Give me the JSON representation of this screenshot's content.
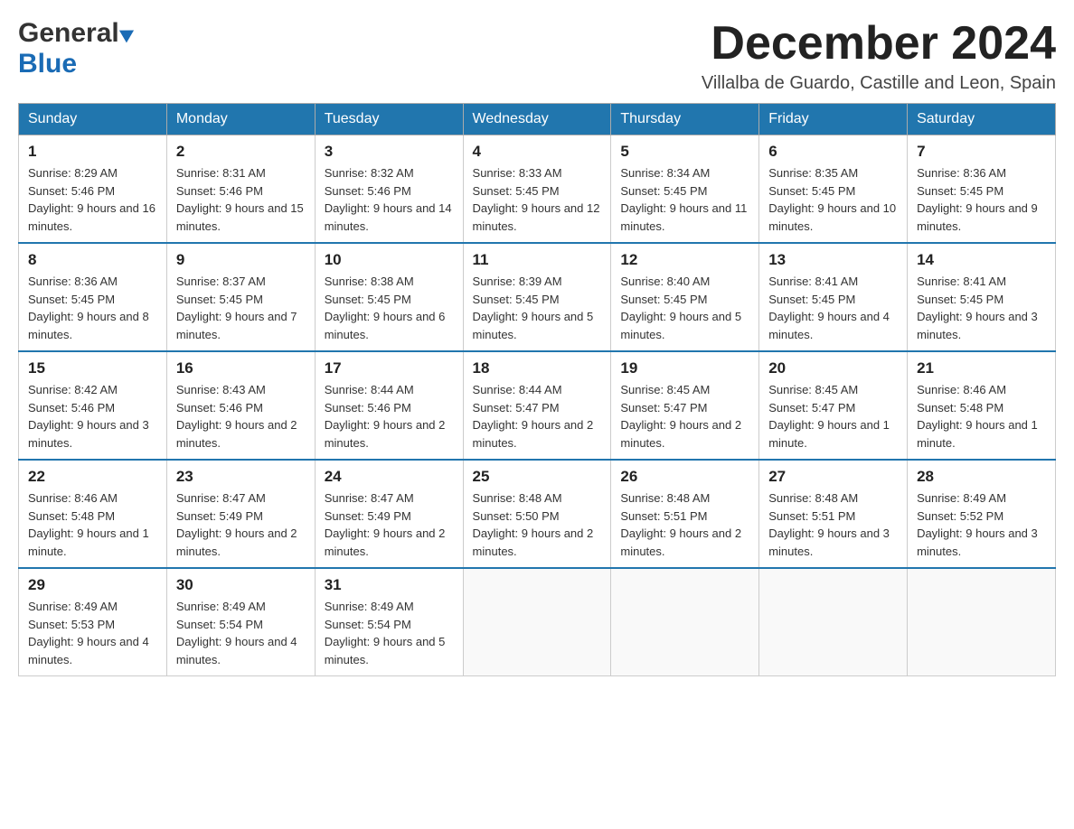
{
  "header": {
    "logo_general": "General",
    "logo_blue": "Blue",
    "month_title": "December 2024",
    "subtitle": "Villalba de Guardo, Castille and Leon, Spain"
  },
  "days_of_week": [
    "Sunday",
    "Monday",
    "Tuesday",
    "Wednesday",
    "Thursday",
    "Friday",
    "Saturday"
  ],
  "weeks": [
    [
      {
        "day": "1",
        "sunrise": "Sunrise: 8:29 AM",
        "sunset": "Sunset: 5:46 PM",
        "daylight": "Daylight: 9 hours and 16 minutes."
      },
      {
        "day": "2",
        "sunrise": "Sunrise: 8:31 AM",
        "sunset": "Sunset: 5:46 PM",
        "daylight": "Daylight: 9 hours and 15 minutes."
      },
      {
        "day": "3",
        "sunrise": "Sunrise: 8:32 AM",
        "sunset": "Sunset: 5:46 PM",
        "daylight": "Daylight: 9 hours and 14 minutes."
      },
      {
        "day": "4",
        "sunrise": "Sunrise: 8:33 AM",
        "sunset": "Sunset: 5:45 PM",
        "daylight": "Daylight: 9 hours and 12 minutes."
      },
      {
        "day": "5",
        "sunrise": "Sunrise: 8:34 AM",
        "sunset": "Sunset: 5:45 PM",
        "daylight": "Daylight: 9 hours and 11 minutes."
      },
      {
        "day": "6",
        "sunrise": "Sunrise: 8:35 AM",
        "sunset": "Sunset: 5:45 PM",
        "daylight": "Daylight: 9 hours and 10 minutes."
      },
      {
        "day": "7",
        "sunrise": "Sunrise: 8:36 AM",
        "sunset": "Sunset: 5:45 PM",
        "daylight": "Daylight: 9 hours and 9 minutes."
      }
    ],
    [
      {
        "day": "8",
        "sunrise": "Sunrise: 8:36 AM",
        "sunset": "Sunset: 5:45 PM",
        "daylight": "Daylight: 9 hours and 8 minutes."
      },
      {
        "day": "9",
        "sunrise": "Sunrise: 8:37 AM",
        "sunset": "Sunset: 5:45 PM",
        "daylight": "Daylight: 9 hours and 7 minutes."
      },
      {
        "day": "10",
        "sunrise": "Sunrise: 8:38 AM",
        "sunset": "Sunset: 5:45 PM",
        "daylight": "Daylight: 9 hours and 6 minutes."
      },
      {
        "day": "11",
        "sunrise": "Sunrise: 8:39 AM",
        "sunset": "Sunset: 5:45 PM",
        "daylight": "Daylight: 9 hours and 5 minutes."
      },
      {
        "day": "12",
        "sunrise": "Sunrise: 8:40 AM",
        "sunset": "Sunset: 5:45 PM",
        "daylight": "Daylight: 9 hours and 5 minutes."
      },
      {
        "day": "13",
        "sunrise": "Sunrise: 8:41 AM",
        "sunset": "Sunset: 5:45 PM",
        "daylight": "Daylight: 9 hours and 4 minutes."
      },
      {
        "day": "14",
        "sunrise": "Sunrise: 8:41 AM",
        "sunset": "Sunset: 5:45 PM",
        "daylight": "Daylight: 9 hours and 3 minutes."
      }
    ],
    [
      {
        "day": "15",
        "sunrise": "Sunrise: 8:42 AM",
        "sunset": "Sunset: 5:46 PM",
        "daylight": "Daylight: 9 hours and 3 minutes."
      },
      {
        "day": "16",
        "sunrise": "Sunrise: 8:43 AM",
        "sunset": "Sunset: 5:46 PM",
        "daylight": "Daylight: 9 hours and 2 minutes."
      },
      {
        "day": "17",
        "sunrise": "Sunrise: 8:44 AM",
        "sunset": "Sunset: 5:46 PM",
        "daylight": "Daylight: 9 hours and 2 minutes."
      },
      {
        "day": "18",
        "sunrise": "Sunrise: 8:44 AM",
        "sunset": "Sunset: 5:47 PM",
        "daylight": "Daylight: 9 hours and 2 minutes."
      },
      {
        "day": "19",
        "sunrise": "Sunrise: 8:45 AM",
        "sunset": "Sunset: 5:47 PM",
        "daylight": "Daylight: 9 hours and 2 minutes."
      },
      {
        "day": "20",
        "sunrise": "Sunrise: 8:45 AM",
        "sunset": "Sunset: 5:47 PM",
        "daylight": "Daylight: 9 hours and 1 minute."
      },
      {
        "day": "21",
        "sunrise": "Sunrise: 8:46 AM",
        "sunset": "Sunset: 5:48 PM",
        "daylight": "Daylight: 9 hours and 1 minute."
      }
    ],
    [
      {
        "day": "22",
        "sunrise": "Sunrise: 8:46 AM",
        "sunset": "Sunset: 5:48 PM",
        "daylight": "Daylight: 9 hours and 1 minute."
      },
      {
        "day": "23",
        "sunrise": "Sunrise: 8:47 AM",
        "sunset": "Sunset: 5:49 PM",
        "daylight": "Daylight: 9 hours and 2 minutes."
      },
      {
        "day": "24",
        "sunrise": "Sunrise: 8:47 AM",
        "sunset": "Sunset: 5:49 PM",
        "daylight": "Daylight: 9 hours and 2 minutes."
      },
      {
        "day": "25",
        "sunrise": "Sunrise: 8:48 AM",
        "sunset": "Sunset: 5:50 PM",
        "daylight": "Daylight: 9 hours and 2 minutes."
      },
      {
        "day": "26",
        "sunrise": "Sunrise: 8:48 AM",
        "sunset": "Sunset: 5:51 PM",
        "daylight": "Daylight: 9 hours and 2 minutes."
      },
      {
        "day": "27",
        "sunrise": "Sunrise: 8:48 AM",
        "sunset": "Sunset: 5:51 PM",
        "daylight": "Daylight: 9 hours and 3 minutes."
      },
      {
        "day": "28",
        "sunrise": "Sunrise: 8:49 AM",
        "sunset": "Sunset: 5:52 PM",
        "daylight": "Daylight: 9 hours and 3 minutes."
      }
    ],
    [
      {
        "day": "29",
        "sunrise": "Sunrise: 8:49 AM",
        "sunset": "Sunset: 5:53 PM",
        "daylight": "Daylight: 9 hours and 4 minutes."
      },
      {
        "day": "30",
        "sunrise": "Sunrise: 8:49 AM",
        "sunset": "Sunset: 5:54 PM",
        "daylight": "Daylight: 9 hours and 4 minutes."
      },
      {
        "day": "31",
        "sunrise": "Sunrise: 8:49 AM",
        "sunset": "Sunset: 5:54 PM",
        "daylight": "Daylight: 9 hours and 5 minutes."
      },
      {
        "day": "",
        "sunrise": "",
        "sunset": "",
        "daylight": ""
      },
      {
        "day": "",
        "sunrise": "",
        "sunset": "",
        "daylight": ""
      },
      {
        "day": "",
        "sunrise": "",
        "sunset": "",
        "daylight": ""
      },
      {
        "day": "",
        "sunrise": "",
        "sunset": "",
        "daylight": ""
      }
    ]
  ]
}
